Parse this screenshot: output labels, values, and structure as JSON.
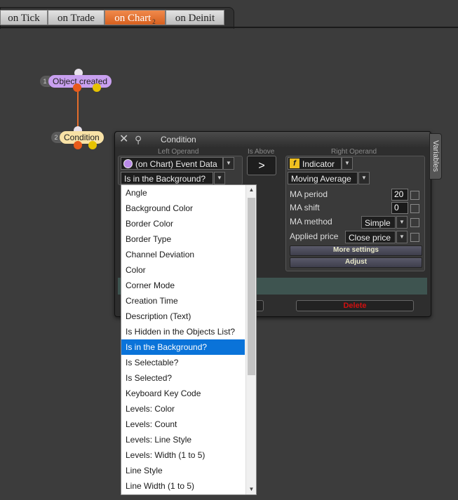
{
  "tabs": [
    {
      "label": "on Tick",
      "active": false
    },
    {
      "label": "on Trade",
      "active": false
    },
    {
      "label": "on Chart",
      "active": true,
      "badge": "2"
    },
    {
      "label": "on Deinit",
      "active": false
    }
  ],
  "nodes": [
    {
      "index": "1",
      "label": "Object created",
      "color": "#c9a0f0"
    },
    {
      "index": "2",
      "label": "Condition",
      "color": "#f8e2a6"
    }
  ],
  "panel": {
    "title": "Condition",
    "left_header": "Left Operand",
    "compare_header": "Is Above",
    "right_header": "Right Operand",
    "left_source": "(on Chart) Event Data",
    "left_property": "Is in the Background?",
    "compare_op": ">",
    "right_source_icon": "f",
    "right_source": "Indicator",
    "right_indicator": "Moving Average",
    "ma_period_label": "MA period",
    "ma_period_value": "20",
    "ma_shift_label": "MA shift",
    "ma_shift_value": "0",
    "ma_method_label": "MA method",
    "ma_method_value": "Simple",
    "applied_price_label": "Applied price",
    "applied_price_value": "Close price",
    "more_settings": "More settings",
    "adjust": "Adjust",
    "delete": "Delete"
  },
  "variables_tab": "Variables",
  "dropdown": {
    "items": [
      "Angle",
      "Background Color",
      "Border Color",
      "Border Type",
      "Channel Deviation",
      "Color",
      "Corner Mode",
      "Creation Time",
      "Description (Text)",
      "Is Hidden in the Objects List?",
      "Is in the Background?",
      "Is Selectable?",
      "Is Selected?",
      "Keyboard Key Code",
      "Levels: Color",
      "Levels: Count",
      "Levels: Line Style",
      "Levels: Width (1 to 5)",
      "Line Style",
      "Line Width (1 to 5)"
    ],
    "selected": "Is in the Background?"
  },
  "colors": {
    "background": "#3c3c3c",
    "active_tab": "#e46d2b",
    "selection": "#0a73d9",
    "delete_text": "#d01010"
  }
}
